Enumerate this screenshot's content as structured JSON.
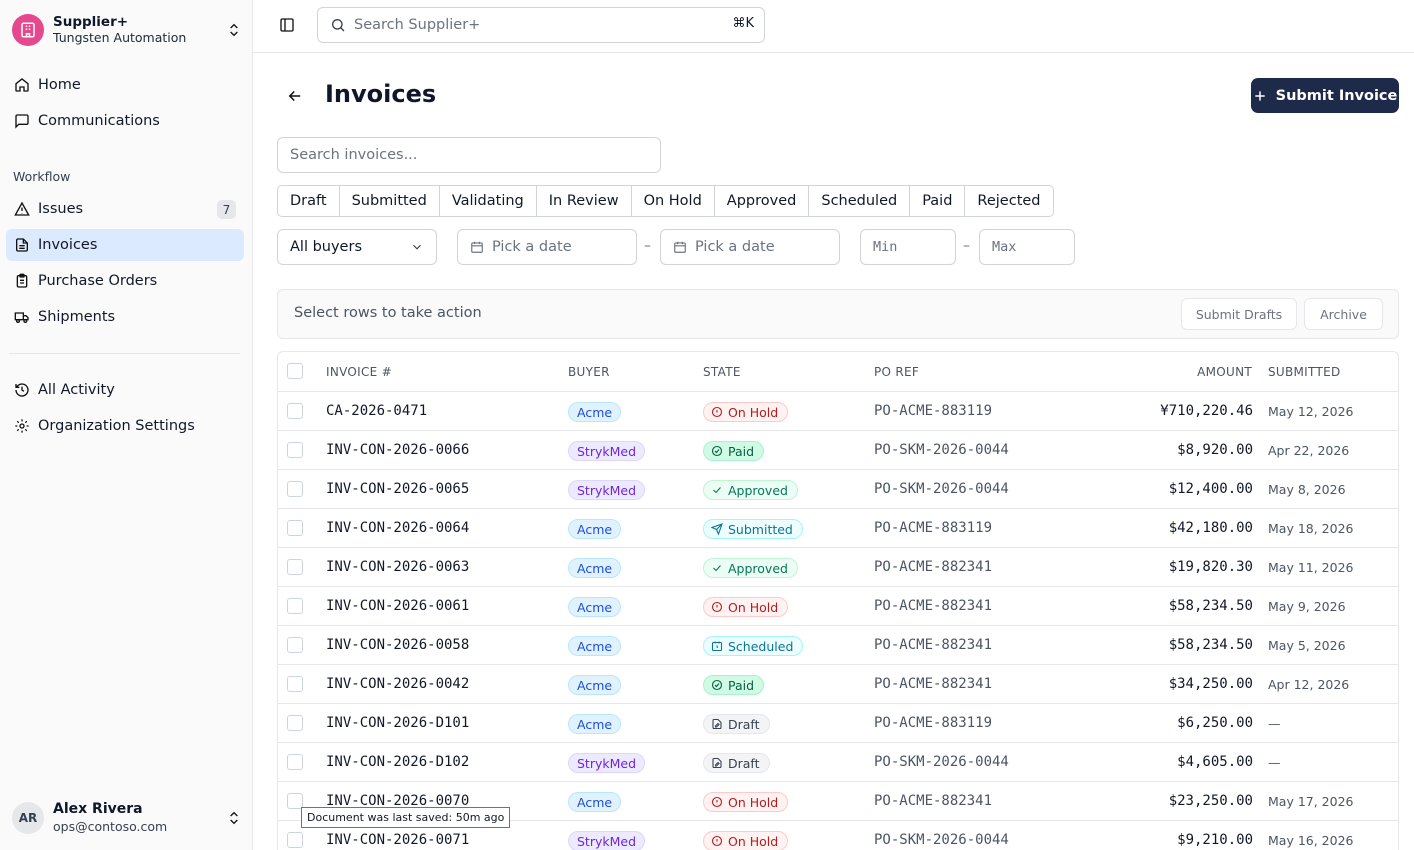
{
  "org": {
    "name": "Supplier+",
    "subtitle": "Tungsten Automation",
    "logo_icon": "building-icon",
    "accent": "#e5488c"
  },
  "nav": {
    "home": "Home",
    "communications": "Communications",
    "section_workflow": "Workflow",
    "issues": "Issues",
    "issues_count": "7",
    "invoices": "Invoices",
    "purchase_orders": "Purchase Orders",
    "shipments": "Shipments",
    "all_activity": "All Activity",
    "org_settings": "Organization Settings"
  },
  "user": {
    "initials": "AR",
    "name": "Alex Rivera",
    "email": "ops@contoso.com"
  },
  "topbar": {
    "search_placeholder": "Search Supplier+",
    "shortcut": "⌘K"
  },
  "page": {
    "title": "Invoices",
    "submit_label": "Submit Invoice",
    "search_placeholder": "Search invoices...",
    "tabs": [
      "Draft",
      "Submitted",
      "Validating",
      "In Review",
      "On Hold",
      "Approved",
      "Scheduled",
      "Paid",
      "Rejected"
    ],
    "filters": {
      "buyer": "All buyers",
      "date_from": "Pick a date",
      "date_to": "Pick a date",
      "min": "Min",
      "max": "Max",
      "separator": "–"
    },
    "actionbar": {
      "text": "Select rows to take action",
      "submit_drafts": "Submit Drafts",
      "archive": "Archive"
    }
  },
  "table": {
    "headers": {
      "invoice": "INVOICE #",
      "buyer": "BUYER",
      "state": "STATE",
      "po": "PO REF",
      "amount": "AMOUNT",
      "submitted": "SUBMITTED"
    },
    "rows": [
      {
        "invoice": "CA-2026-0471",
        "buyer": "Acme",
        "state": "On Hold",
        "po": "PO-ACME-883119",
        "amount": "¥710,220.46",
        "submitted": "May 12, 2026"
      },
      {
        "invoice": "INV-CON-2026-0066",
        "buyer": "StrykMed",
        "state": "Paid",
        "po": "PO-SKM-2026-0044",
        "amount": "$8,920.00",
        "submitted": "Apr 22, 2026"
      },
      {
        "invoice": "INV-CON-2026-0065",
        "buyer": "StrykMed",
        "state": "Approved",
        "po": "PO-SKM-2026-0044",
        "amount": "$12,400.00",
        "submitted": "May 8, 2026"
      },
      {
        "invoice": "INV-CON-2026-0064",
        "buyer": "Acme",
        "state": "Submitted",
        "po": "PO-ACME-883119",
        "amount": "$42,180.00",
        "submitted": "May 18, 2026"
      },
      {
        "invoice": "INV-CON-2026-0063",
        "buyer": "Acme",
        "state": "Approved",
        "po": "PO-ACME-882341",
        "amount": "$19,820.30",
        "submitted": "May 11, 2026"
      },
      {
        "invoice": "INV-CON-2026-0061",
        "buyer": "Acme",
        "state": "On Hold",
        "po": "PO-ACME-882341",
        "amount": "$58,234.50",
        "submitted": "May 9, 2026"
      },
      {
        "invoice": "INV-CON-2026-0058",
        "buyer": "Acme",
        "state": "Scheduled",
        "po": "PO-ACME-882341",
        "amount": "$58,234.50",
        "submitted": "May 5, 2026"
      },
      {
        "invoice": "INV-CON-2026-0042",
        "buyer": "Acme",
        "state": "Paid",
        "po": "PO-ACME-882341",
        "amount": "$34,250.00",
        "submitted": "Apr 12, 2026"
      },
      {
        "invoice": "INV-CON-2026-D101",
        "buyer": "Acme",
        "state": "Draft",
        "po": "PO-ACME-883119",
        "amount": "$6,250.00",
        "submitted": "—"
      },
      {
        "invoice": "INV-CON-2026-D102",
        "buyer": "StrykMed",
        "state": "Draft",
        "po": "PO-SKM-2026-0044",
        "amount": "$4,605.00",
        "submitted": "—"
      },
      {
        "invoice": "INV-CON-2026-0070",
        "buyer": "Acme",
        "state": "On Hold",
        "po": "PO-ACME-882341",
        "amount": "$23,250.00",
        "submitted": "May 17, 2026"
      },
      {
        "invoice": "INV-CON-2026-0071",
        "buyer": "StrykMed",
        "state": "On Hold",
        "po": "PO-SKM-2026-0044",
        "amount": "$9,210.00",
        "submitted": "May 16, 2026"
      }
    ]
  },
  "tooltip": "Document was last saved: 50m ago",
  "colors": {
    "primary": "#1e2a4a",
    "active_nav": "#dbeafe"
  }
}
